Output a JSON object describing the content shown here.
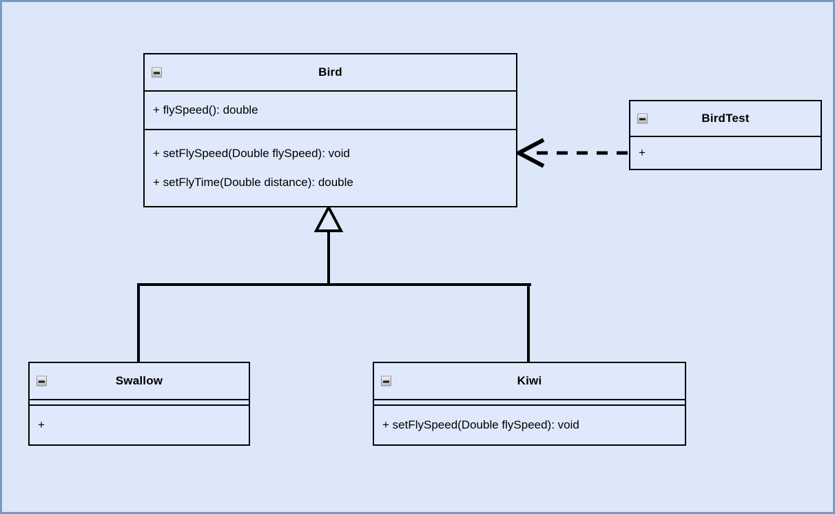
{
  "diagram": {
    "type": "uml-class-diagram",
    "background_color": "#dce8fa",
    "border_color": "#7a99c2",
    "class_fill_color": "#dfe9fb",
    "line_color": "#000000"
  },
  "classes": {
    "bird": {
      "name": "Bird",
      "collapse_icon": "minus-box-icon",
      "attributes": [
        "+ flySpeed(): double"
      ],
      "methods": [
        "+ setFlySpeed(Double flySpeed): void",
        "+ setFlyTime(Double distance): double"
      ]
    },
    "birdtest": {
      "name": "BirdTest",
      "collapse_icon": "minus-box-icon",
      "members": [
        "+"
      ]
    },
    "swallow": {
      "name": "Swallow",
      "collapse_icon": "minus-box-icon",
      "attributes": [],
      "methods": [
        "+"
      ]
    },
    "kiwi": {
      "name": "Kiwi",
      "collapse_icon": "minus-box-icon",
      "attributes": [],
      "methods": [
        "+ setFlySpeed(Double flySpeed): void"
      ]
    }
  },
  "relationships": [
    {
      "id": "swallow-extends-bird",
      "type": "generalization",
      "from": "Swallow",
      "to": "Bird",
      "arrowhead": "hollow-triangle",
      "line_style": "solid"
    },
    {
      "id": "kiwi-extends-bird",
      "type": "generalization",
      "from": "Kiwi",
      "to": "Bird",
      "arrowhead": "hollow-triangle",
      "line_style": "solid"
    },
    {
      "id": "birdtest-depends-bird",
      "type": "dependency",
      "from": "BirdTest",
      "to": "Bird",
      "arrowhead": "open-arrow",
      "line_style": "dashed"
    }
  ]
}
